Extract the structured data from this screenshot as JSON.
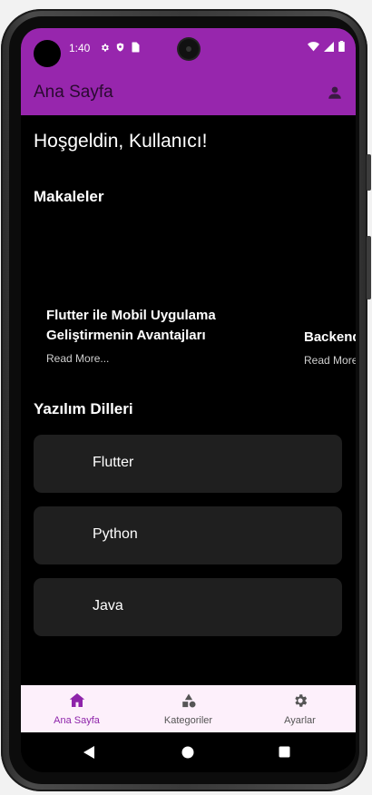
{
  "status": {
    "time": "1:40"
  },
  "appbar": {
    "title": "Ana Sayfa"
  },
  "content": {
    "greeting": "Hoşgeldin, Kullanıcı!",
    "articles_title": "Makaleler",
    "articles": [
      {
        "title": "Flutter ile Mobil Uygulama Geliştirmenin Avantajları",
        "read_more": "Read More..."
      },
      {
        "title": "Backend",
        "read_more": "Read More..."
      }
    ],
    "languages_title": "Yazılım Dilleri",
    "languages": [
      "Flutter",
      "Python",
      "Java"
    ]
  },
  "bottom_nav": {
    "items": [
      {
        "label": "Ana Sayfa",
        "icon": "home-icon",
        "active": true
      },
      {
        "label": "Kategoriler",
        "icon": "category-icon",
        "active": false
      },
      {
        "label": "Ayarlar",
        "icon": "settings-icon",
        "active": false
      }
    ],
    "active_color": "#8e24aa",
    "inactive_color": "#555555"
  },
  "colors": {
    "primary": "#9726ad",
    "background": "#000000",
    "card": "#1f1f1f"
  }
}
